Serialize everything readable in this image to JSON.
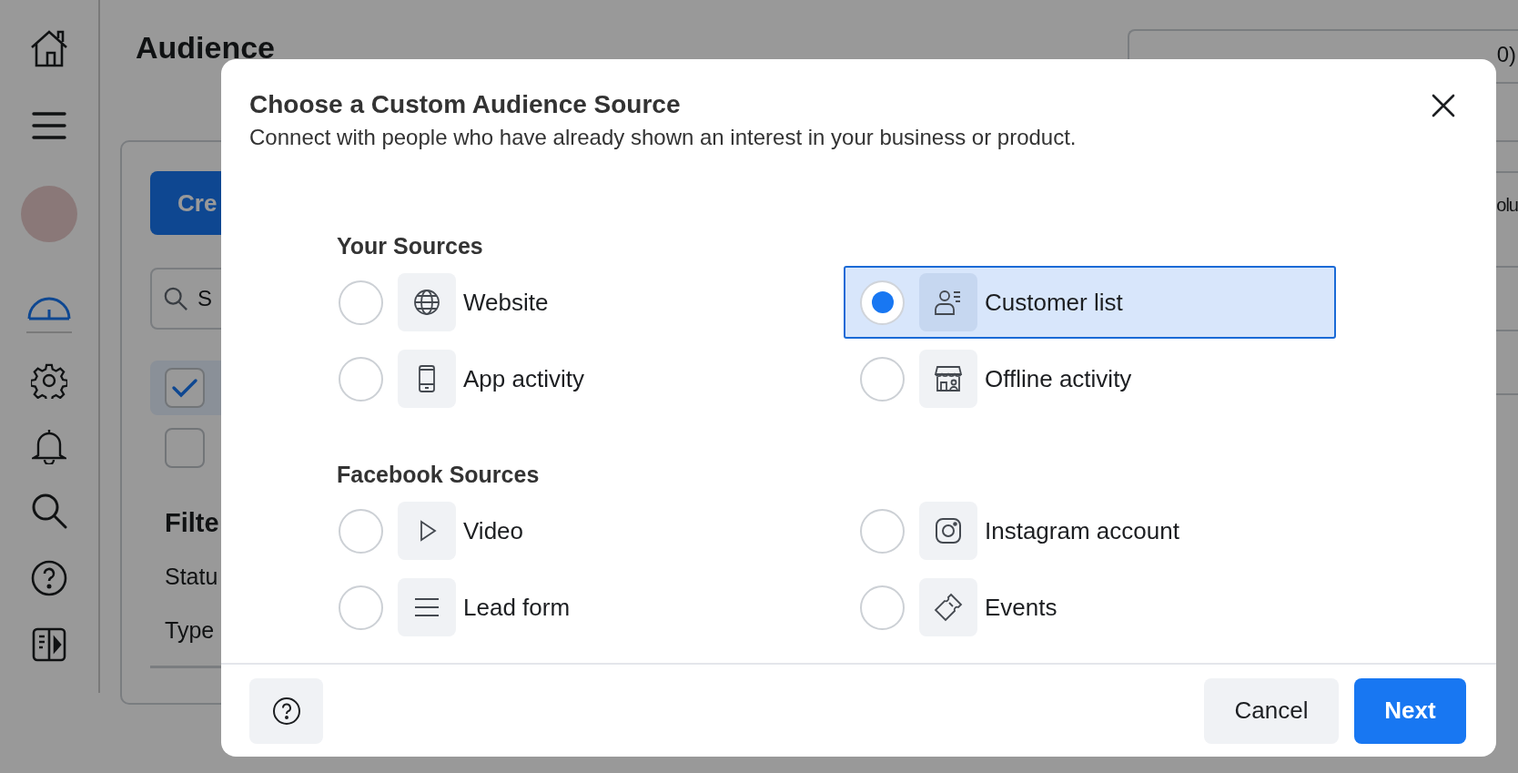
{
  "sidebar": {
    "items": [
      {
        "kind": "home",
        "selected": false
      },
      {
        "kind": "menu",
        "selected": false
      },
      {
        "kind": "avatar",
        "selected": false
      },
      {
        "kind": "gauge",
        "selected": true
      },
      {
        "kind": "gear",
        "selected": false
      },
      {
        "kind": "bell",
        "selected": false
      },
      {
        "kind": "search",
        "selected": false
      },
      {
        "kind": "help",
        "selected": false
      },
      {
        "kind": "panel",
        "selected": false
      }
    ]
  },
  "page_title": "Audience",
  "account_selector": "0)",
  "create_button": "Cre",
  "search": {
    "placeholder": "S"
  },
  "list_rows": [
    {
      "checked": true,
      "selected": true
    },
    {
      "checked": false,
      "selected": false
    }
  ],
  "filters": {
    "title": "Filte",
    "items": [
      "Statu",
      "Type"
    ]
  },
  "column_heading": "olu",
  "dialog": {
    "title": "Choose a Custom Audience Source",
    "subtitle": "Connect with people who have already shown an interest in your business or product.",
    "sections": [
      {
        "title": "Your Sources",
        "options": [
          {
            "label": "Website",
            "kind": "globe",
            "selected": false
          },
          {
            "label": "Customer list",
            "kind": "contact",
            "selected": true
          },
          {
            "label": "App activity",
            "kind": "phone",
            "selected": false
          },
          {
            "label": "Offline activity",
            "kind": "store",
            "selected": false
          }
        ]
      },
      {
        "title": "Facebook Sources",
        "options": [
          {
            "label": "Video",
            "kind": "play",
            "selected": false
          },
          {
            "label": "Instagram account",
            "kind": "camera",
            "selected": false
          },
          {
            "label": "Lead form",
            "kind": "lines",
            "selected": false
          },
          {
            "label": "Events",
            "kind": "ticket",
            "selected": false
          }
        ]
      }
    ],
    "buttons": [
      {
        "label": "Cancel",
        "kind": "secondary"
      },
      {
        "label": "Next",
        "kind": "primary"
      }
    ]
  }
}
